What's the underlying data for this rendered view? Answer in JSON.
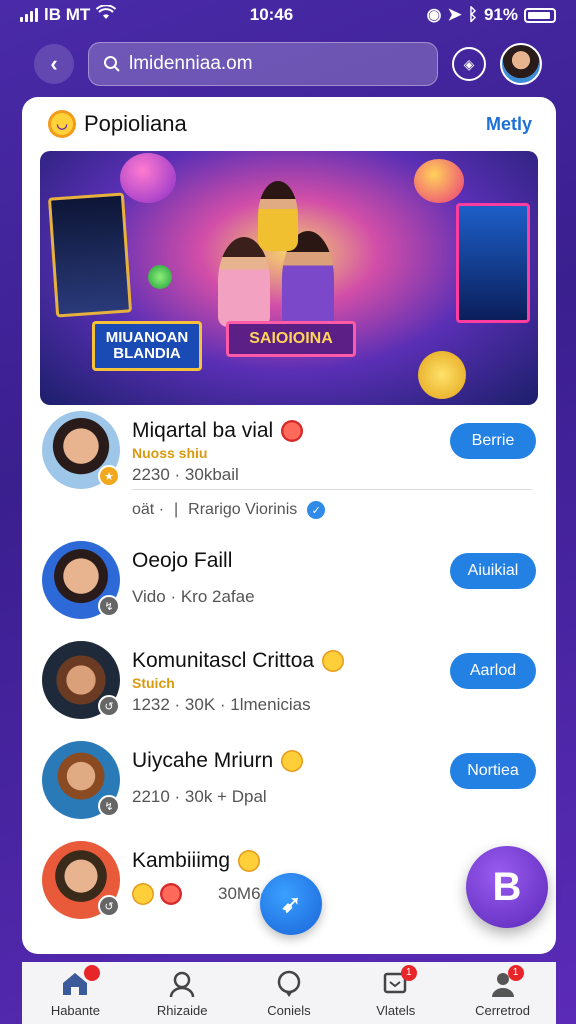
{
  "status_bar": {
    "carrier": "lB MT",
    "time": "10:46",
    "battery": "91%"
  },
  "header": {
    "search_value": "lmidenniaa.om",
    "search_placeholder": "lmidenniaa.om"
  },
  "card": {
    "title": "Popioliana",
    "more_label": "Metly"
  },
  "banner": {
    "sign_left": "MIUANOAN BLANDIA",
    "sign_center": "SAIOIOINA"
  },
  "list": [
    {
      "name": "Miqartal ba vial",
      "tag": "Nuoss shiu",
      "meta": "2230 · 30kbail",
      "button": "Berrie",
      "sub_left": "oät ·",
      "sub_right": "Rrarigo Viorinis"
    },
    {
      "name": "Oeojo Faill",
      "tag": "",
      "meta": "Vido · Kro 2afae",
      "button": "Aiuikial"
    },
    {
      "name": "Komunitascl Crittoa",
      "tag": "Stuich",
      "meta": "1232 · 30K · 1lmenicias",
      "button": "Aarlod"
    },
    {
      "name": "Uiycahe Mriurn",
      "tag": "",
      "meta": "2210 · 30k + Dpal",
      "button": "Nortiea"
    },
    {
      "name": "Kambiiimg",
      "tag": "",
      "meta": "30M6- ·",
      "button": ""
    }
  ],
  "fab_right_label": "B",
  "bottom_nav": [
    {
      "label": "Habante",
      "badge": ""
    },
    {
      "label": "Rhizaide",
      "badge": ""
    },
    {
      "label": "Coniels",
      "badge": ""
    },
    {
      "label": "Vlatels",
      "badge": "1"
    },
    {
      "label": "Cerretrod",
      "badge": "1"
    }
  ],
  "colors": {
    "accent": "#2281e3",
    "background": "#4a2aa8",
    "fab_purple": "#7a40d8"
  }
}
